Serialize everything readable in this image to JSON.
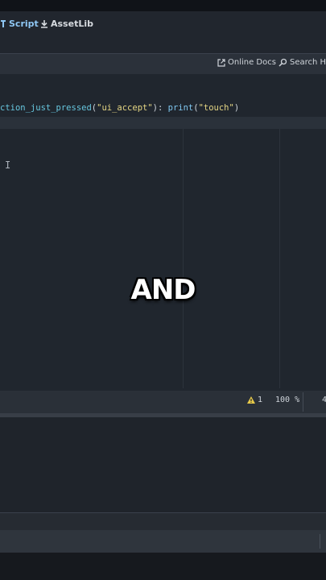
{
  "topbar": {
    "script_label": "Script",
    "assetlib_label": "AssetLib"
  },
  "toolbar": {
    "online_docs_label": "Online Docs",
    "search_help_label": "Search He"
  },
  "editor": {
    "code_fn": "ction_just_pressed",
    "code_open": "(",
    "code_arg": "\"ui_accept\"",
    "code_mid": "): ",
    "code_print": "print",
    "code_paren": "(",
    "code_str": "\"touch\"",
    "code_close": ")"
  },
  "caption": "AND",
  "statusbar": {
    "warning_count": "1",
    "zoom": "100 %",
    "column": "4"
  },
  "colors": {
    "accent": "#8fc7f4",
    "warning": "#e6c94a",
    "string": "#e6d784"
  }
}
